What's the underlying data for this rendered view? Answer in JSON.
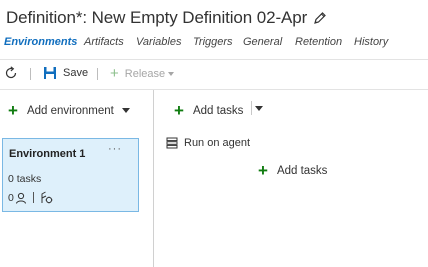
{
  "header": {
    "title": "Definition*: New Empty Definition 02-Apr"
  },
  "tabs": [
    {
      "label": "Environments",
      "active": true
    },
    {
      "label": "Artifacts",
      "active": false
    },
    {
      "label": "Variables",
      "active": false
    },
    {
      "label": "Triggers",
      "active": false
    },
    {
      "label": "General",
      "active": false
    },
    {
      "label": "Retention",
      "active": false
    },
    {
      "label": "History",
      "active": false
    }
  ],
  "toolbar": {
    "save_label": "Save",
    "release_label": "Release"
  },
  "environments_pane": {
    "add_environment_label": "Add environment",
    "environment_card": {
      "name": "Environment 1",
      "more_label": "···",
      "tasks_label": "0 tasks",
      "approvers_count": "0"
    }
  },
  "tasks_pane": {
    "add_tasks_label": "Add tasks",
    "run_on_agent_label": "Run on agent",
    "add_tasks_center_label": "Add tasks"
  },
  "colors": {
    "accent": "#106ebe",
    "add_green": "#107c10",
    "card_background": "#def0fb",
    "card_border": "#7ab8e4"
  }
}
